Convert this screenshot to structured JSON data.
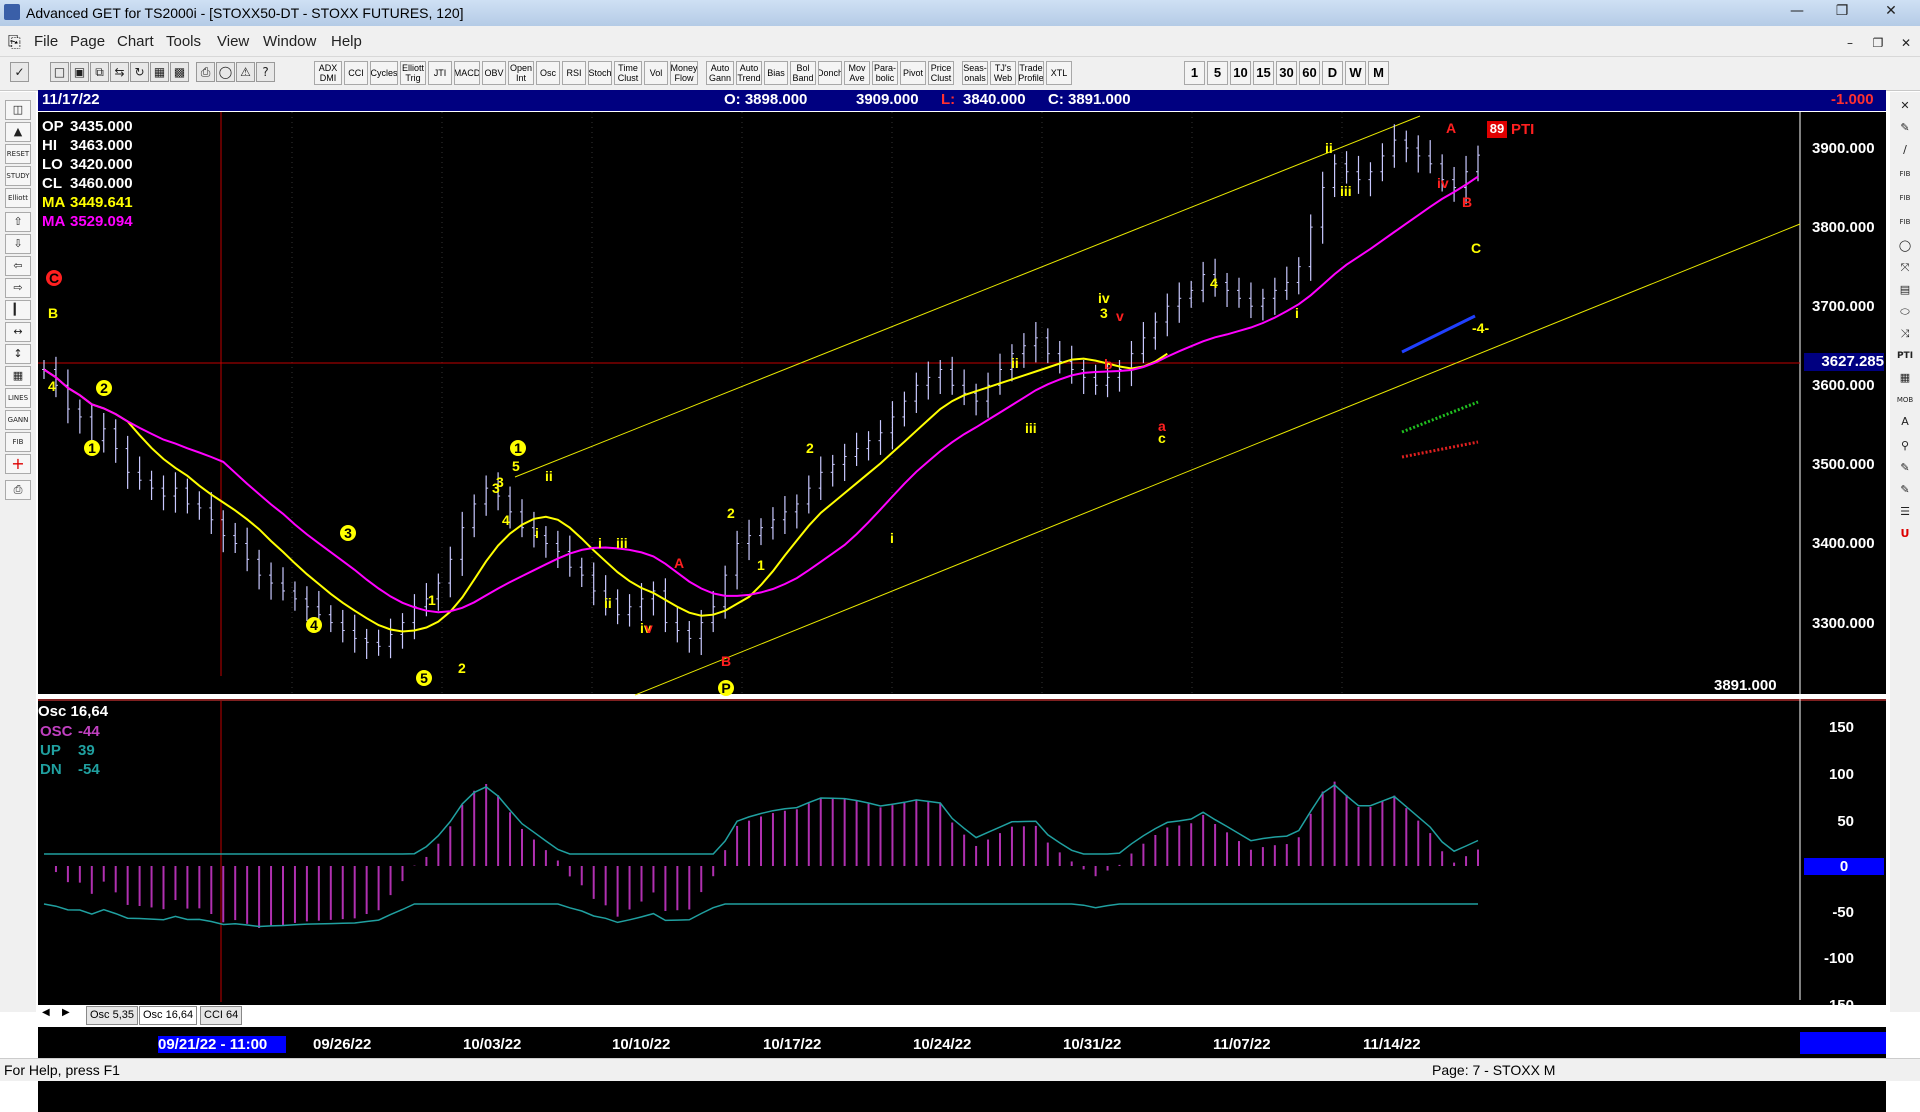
{
  "window": {
    "title": "Advanced GET for TS2000i - [STOXX50-DT - STOXX FUTURES, 120]"
  },
  "menu": [
    "File",
    "Page",
    "Chart",
    "Tools",
    "View",
    "Window",
    "Help"
  ],
  "toolbar": {
    "indicators": [
      "ADX DMI",
      "CCI",
      "Cycles",
      "Elliott Trig",
      "JTI",
      "MACD",
      "OBV",
      "Open Int",
      "Osc",
      "RSI",
      "Stoch",
      "Time Clust",
      "Vol",
      "Money Flow",
      "Auto Gann",
      "Auto Trend",
      "Bias",
      "Bol Band",
      "Donch",
      "Mov Ave",
      "Para-bolic",
      "Pivot",
      "Price Clust",
      "Seas-onals",
      "TJ's Web",
      "Trade Profile",
      "XTL"
    ],
    "intervals": [
      "1",
      "5",
      "10",
      "15",
      "30",
      "60",
      "D",
      "W",
      "M"
    ]
  },
  "infobar": {
    "date": "11/17/22",
    "open": "O: 3898.000",
    "high": "3909.000",
    "low_label": "L:",
    "low_value": "3840.000",
    "close": "C: 3891.000",
    "change": "-1.000"
  },
  "legend": [
    {
      "label": "OP",
      "value": "3435.000",
      "color": "#ffffff"
    },
    {
      "label": "HI",
      "value": "3463.000",
      "color": "#ffffff"
    },
    {
      "label": "LO",
      "value": "3420.000",
      "color": "#ffffff"
    },
    {
      "label": "CL",
      "value": "3460.000",
      "color": "#ffffff"
    },
    {
      "label": "MA",
      "value": "3449.641",
      "color": "#ffff00"
    },
    {
      "label": "MA",
      "value": "3529.094",
      "color": "#ff00ff"
    }
  ],
  "price_axis": [
    "3900.000",
    "3800.000",
    "3700.000",
    "3600.000",
    "3500.000",
    "3400.000",
    "3300.000"
  ],
  "price_marker": "3627.285",
  "last_price": "3891.000",
  "pti": {
    "value": "89",
    "label": "PTI"
  },
  "osc_panel": {
    "title": "Osc 16,64",
    "lines": [
      {
        "label": "OSC",
        "value": "-44",
        "color": "#c040c0"
      },
      {
        "label": "UP",
        "value": "39",
        "color": "#20a0a0"
      },
      {
        "label": "DN",
        "value": "-54",
        "color": "#20a0a0"
      }
    ],
    "axis": [
      "150",
      "100",
      "50",
      "0",
      "-50",
      "-100",
      "-150"
    ]
  },
  "tabs": [
    "Osc 5,35",
    "Osc 16,64",
    "CCI 64"
  ],
  "time_axis": {
    "cursor": "09/21/22 - 11:00",
    "labels": [
      "09/26/22",
      "10/03/22",
      "10/10/22",
      "10/17/22",
      "10/24/22",
      "10/31/22",
      "11/07/22",
      "11/14/22"
    ]
  },
  "status": {
    "help": "For Help, press F1",
    "page": "Page: 7 - STOXX M"
  },
  "colors": {
    "ma_fast": "#ffff00",
    "ma_slow": "#ff00ff",
    "channel": "#e8e800",
    "wave_yellow": "#ffff00",
    "wave_red": "#ff2020",
    "panel_bg": "#000000",
    "info_bg": "#000080"
  },
  "elliott_labels": [
    "C",
    "B",
    "4",
    "2",
    "1",
    "3",
    "4",
    "5",
    "1",
    "2",
    "3",
    "1",
    "5",
    "3",
    "4",
    "i",
    "ii",
    "i",
    "ii",
    "iii",
    "iv",
    "v",
    "A",
    "B",
    "P",
    "2",
    "1",
    "2",
    "i",
    "ii",
    "iii",
    "iv",
    "3",
    "v",
    "b",
    "a",
    "c",
    "4",
    "i",
    "ii",
    "iii",
    "iv",
    "A",
    "B",
    "C",
    "-4-",
    "-4-"
  ]
}
